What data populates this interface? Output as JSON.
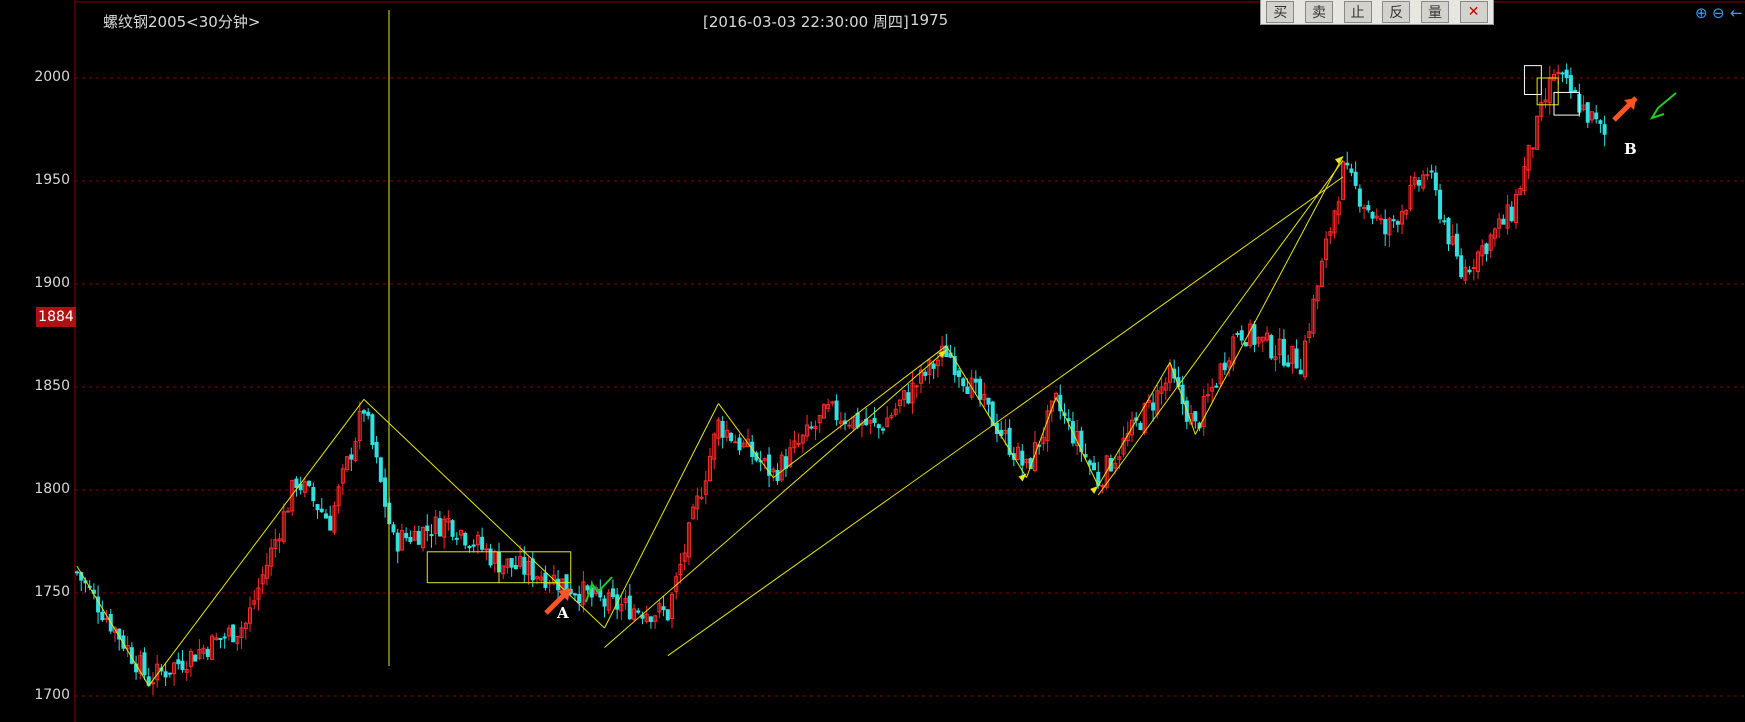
{
  "header": {
    "instrument": "螺纹钢2005<30分钟>",
    "datetime": "[2016-03-03  22:30:00 周四]",
    "last_price": "1975"
  },
  "toolbar": {
    "buttons": [
      "买",
      "卖",
      "止",
      "反",
      "量",
      "✕"
    ]
  },
  "zoom": {
    "zoom_in": "⊕",
    "zoom_out": "⊖",
    "back": "←"
  },
  "current_price_tag": "1884",
  "annotations": {
    "a": "A",
    "b": "B"
  },
  "colors": {
    "up": "#ff2a2a",
    "down": "#33e0e0",
    "grid": "#8b0000",
    "trendline": "#e6e619",
    "frame": "#8b0000"
  },
  "chart_data": {
    "type": "candlestick",
    "title": "螺纹钢2005<30分钟>",
    "ylim": [
      1690,
      2025
    ],
    "yticks": [
      1700,
      1750,
      1800,
      1850,
      1900,
      1950,
      2000
    ],
    "grid": true,
    "zigzag_path": [
      {
        "i": 0,
        "price": 1763
      },
      {
        "i": 17,
        "price": 1705
      },
      {
        "i": 68,
        "price": 1844
      },
      {
        "i": 125,
        "price": 1733
      },
      {
        "i": 152,
        "price": 1842
      },
      {
        "i": 165,
        "price": 1806
      },
      {
        "i": 206,
        "price": 1870
      },
      {
        "i": 225,
        "price": 1806
      },
      {
        "i": 232,
        "price": 1845
      },
      {
        "i": 242,
        "price": 1802
      },
      {
        "i": 259,
        "price": 1862
      },
      {
        "i": 265,
        "price": 1827
      },
      {
        "i": 300,
        "price": 1962
      }
    ],
    "price_pivots": [
      {
        "i": 0,
        "price": 1760
      },
      {
        "i": 17,
        "price": 1708
      },
      {
        "i": 40,
        "price": 1735
      },
      {
        "i": 52,
        "price": 1805
      },
      {
        "i": 60,
        "price": 1785
      },
      {
        "i": 68,
        "price": 1840
      },
      {
        "i": 75,
        "price": 1775
      },
      {
        "i": 88,
        "price": 1785
      },
      {
        "i": 100,
        "price": 1765
      },
      {
        "i": 112,
        "price": 1758
      },
      {
        "i": 125,
        "price": 1745
      },
      {
        "i": 140,
        "price": 1740
      },
      {
        "i": 152,
        "price": 1832
      },
      {
        "i": 165,
        "price": 1808
      },
      {
        "i": 178,
        "price": 1838
      },
      {
        "i": 190,
        "price": 1830
      },
      {
        "i": 206,
        "price": 1868
      },
      {
        "i": 225,
        "price": 1810
      },
      {
        "i": 232,
        "price": 1842
      },
      {
        "i": 242,
        "price": 1805
      },
      {
        "i": 259,
        "price": 1855
      },
      {
        "i": 265,
        "price": 1830
      },
      {
        "i": 275,
        "price": 1878
      },
      {
        "i": 290,
        "price": 1862
      },
      {
        "i": 300,
        "price": 1955
      },
      {
        "i": 310,
        "price": 1925
      },
      {
        "i": 320,
        "price": 1955
      },
      {
        "i": 328,
        "price": 1905
      },
      {
        "i": 340,
        "price": 1935
      },
      {
        "i": 350,
        "price": 2003
      },
      {
        "i": 362,
        "price": 1972
      }
    ]
  }
}
